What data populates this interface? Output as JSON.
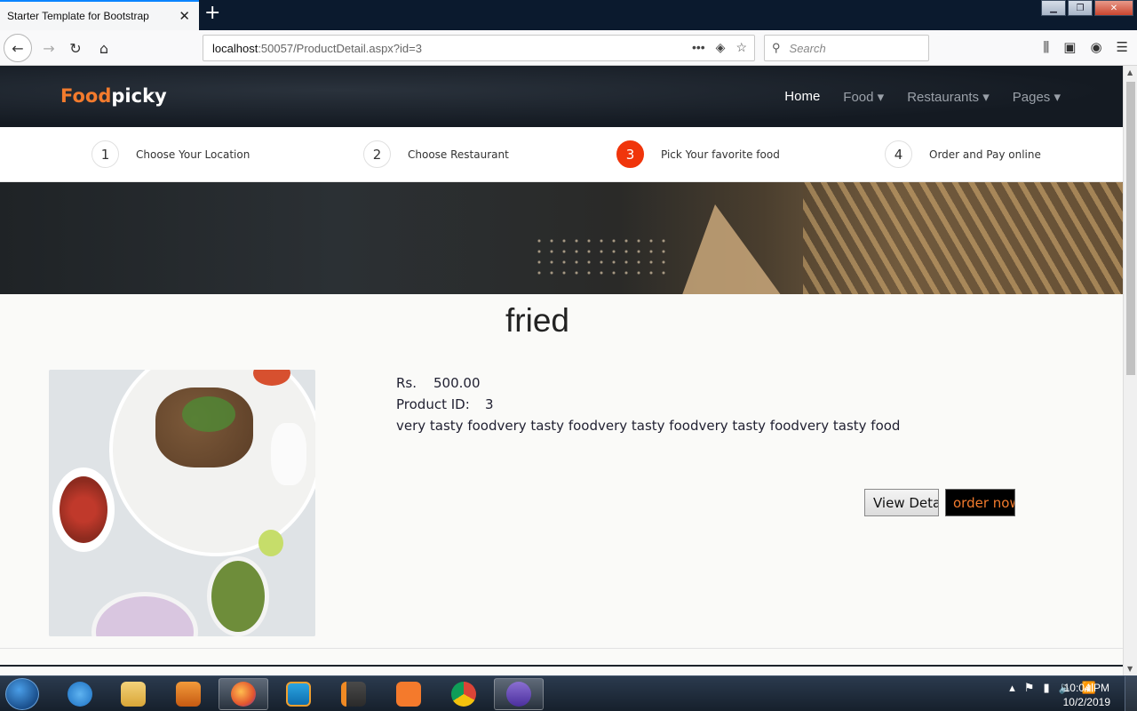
{
  "browser": {
    "tab_title": "Starter Template for Bootstrap",
    "url_host": "localhost",
    "url_path": ":50057/ProductDetail.aspx?id=3",
    "search_placeholder": "Search"
  },
  "site": {
    "logo_part1": "Food",
    "logo_part2": "picky",
    "nav": [
      {
        "label": "Home",
        "active": true
      },
      {
        "label": "Food ▾",
        "active": false
      },
      {
        "label": "Restaurants ▾",
        "active": false
      },
      {
        "label": "Pages ▾",
        "active": false
      }
    ]
  },
  "steps": [
    {
      "num": "1",
      "label": "Choose Your Location",
      "current": false
    },
    {
      "num": "2",
      "label": "Choose Restaurant",
      "current": false
    },
    {
      "num": "3",
      "label": "Pick Your favorite food",
      "current": true
    },
    {
      "num": "4",
      "label": "Order and Pay online",
      "current": false
    }
  ],
  "product": {
    "title": "fried",
    "price_label": "Rs.",
    "price": "500.00",
    "id_label": "Product ID:",
    "id": "3",
    "description": "very tasty foodvery tasty foodvery tasty foodvery tasty foodvery tasty food",
    "view_button": "View Details",
    "order_button": "order now"
  },
  "taskbar": {
    "time": "10:04 PM",
    "date": "10/2/2019",
    "apps": [
      "internet-explorer",
      "file-explorer",
      "media-player",
      "firefox",
      "teamviewer",
      "sublime-text",
      "xampp",
      "chrome",
      "visual-studio"
    ]
  }
}
